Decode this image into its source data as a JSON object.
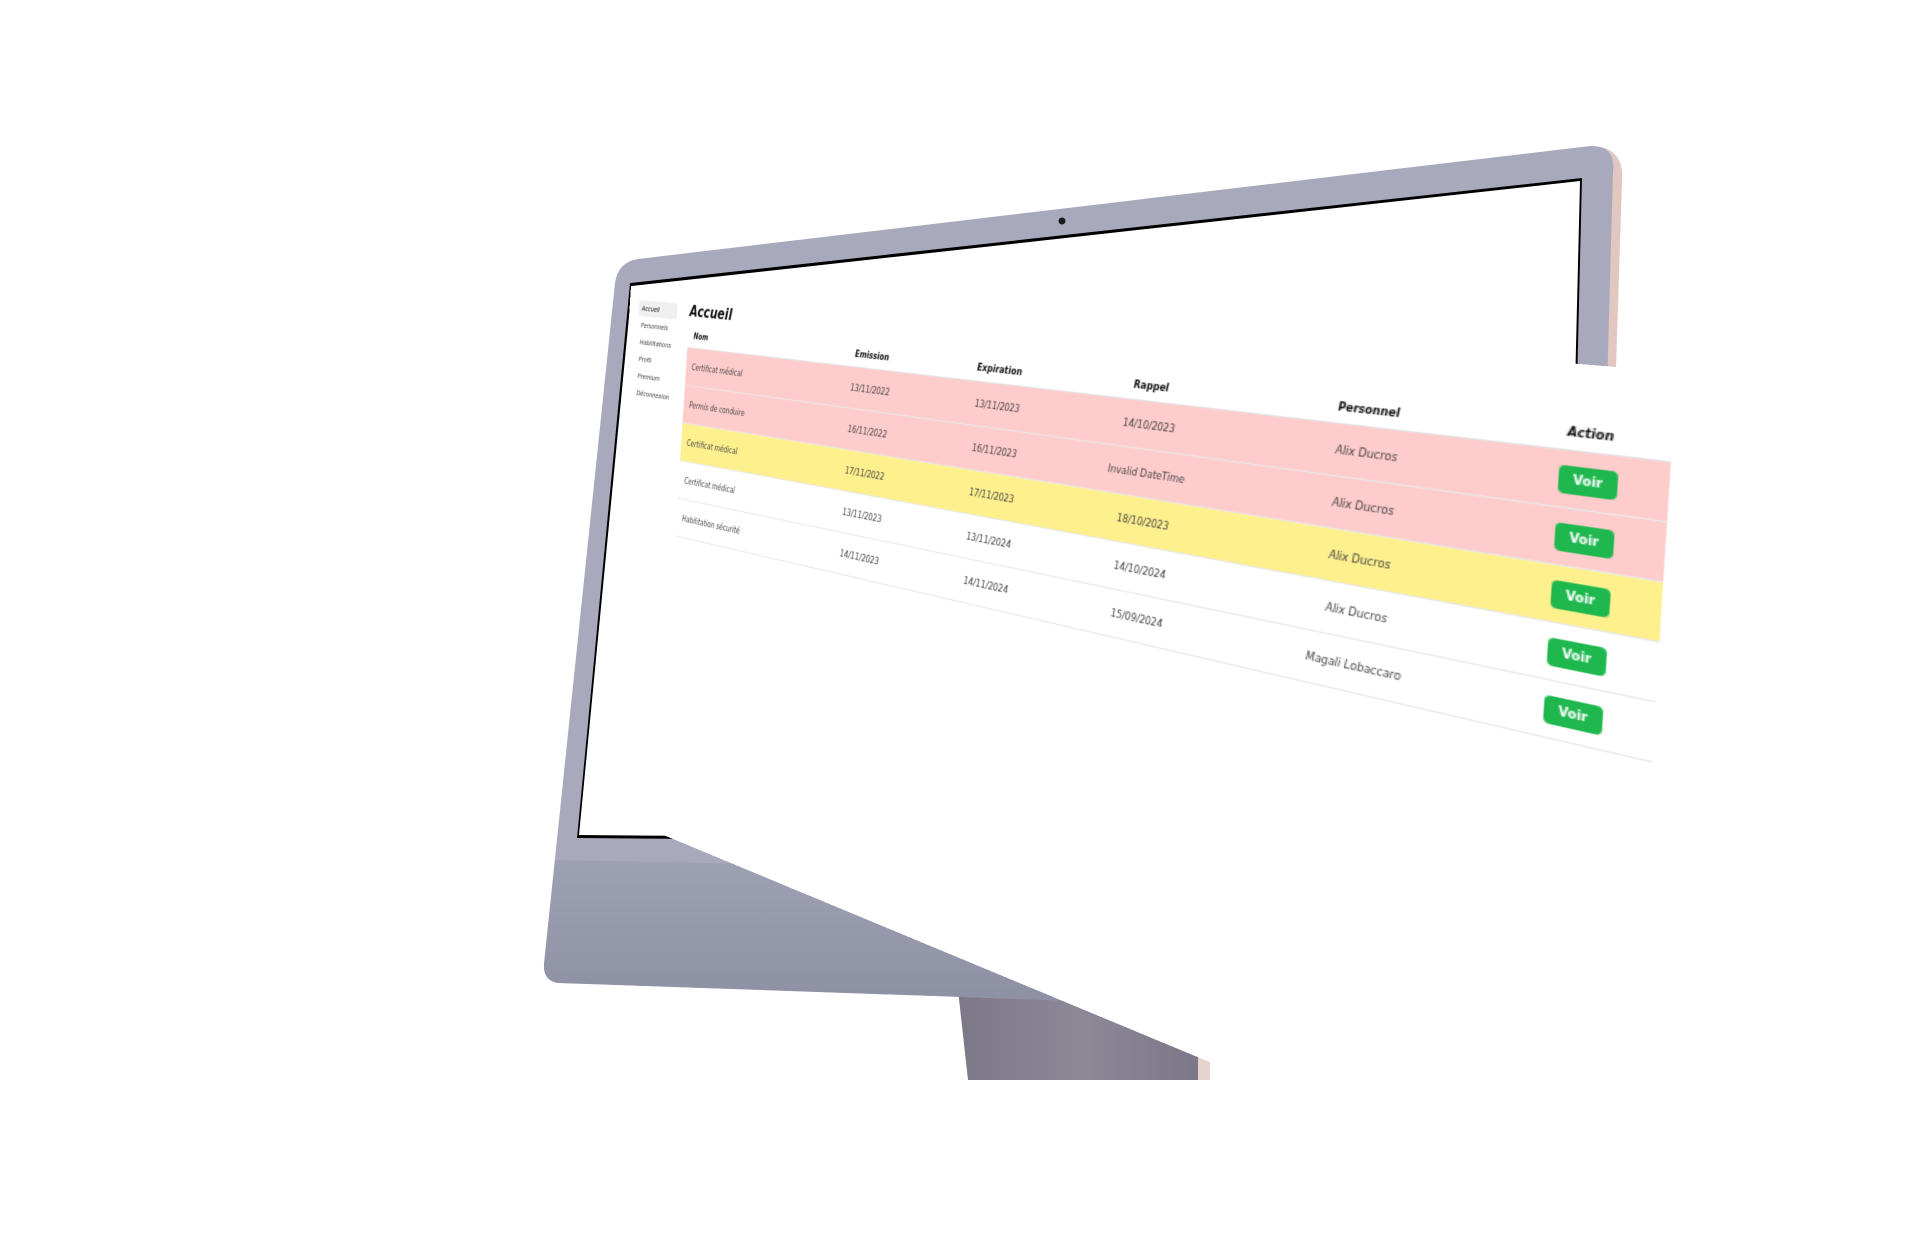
{
  "sidebar": {
    "items": [
      {
        "label": "Accueil",
        "active": true
      },
      {
        "label": "Personnels",
        "active": false
      },
      {
        "label": "Habilitations",
        "active": false
      },
      {
        "label": "Profil",
        "active": false
      },
      {
        "label": "Premium",
        "active": false
      },
      {
        "label": "Déconnexion",
        "active": false
      }
    ]
  },
  "page": {
    "title": "Accueil"
  },
  "table": {
    "headers": {
      "nom": "Nom",
      "emission": "Emission",
      "expiration": "Expiration",
      "rappel": "Rappel",
      "personnel": "Personnel",
      "action": "Action"
    },
    "rows": [
      {
        "nom": "Certificat médical",
        "emission": "13/11/2022",
        "expiration": "13/11/2023",
        "rappel": "14/10/2023",
        "personnel": "Alix Ducros",
        "action": "Voir",
        "status": "red"
      },
      {
        "nom": "Permis de conduire",
        "emission": "16/11/2022",
        "expiration": "16/11/2023",
        "rappel": "Invalid DateTime",
        "personnel": "Alix Ducros",
        "action": "Voir",
        "status": "red"
      },
      {
        "nom": "Certificat médical",
        "emission": "17/11/2022",
        "expiration": "17/11/2023",
        "rappel": "18/10/2023",
        "personnel": "Alix Ducros",
        "action": "Voir",
        "status": "yellow"
      },
      {
        "nom": "Certificat médical",
        "emission": "13/11/2023",
        "expiration": "13/11/2024",
        "rappel": "14/10/2024",
        "personnel": "Alix Ducros",
        "action": "Voir",
        "status": "none"
      },
      {
        "nom": "Habilitation sécurité",
        "emission": "14/11/2023",
        "expiration": "14/11/2024",
        "rappel": "15/09/2024",
        "personnel": "Magali Lobaccaro",
        "action": "Voir",
        "status": "none"
      }
    ]
  },
  "colors": {
    "row_red": "#ffcccc",
    "row_yellow": "#fff08e",
    "button_green": "#1fb84e",
    "monitor_frame": "#a9a9be",
    "monitor_chin": "#9496aa"
  }
}
